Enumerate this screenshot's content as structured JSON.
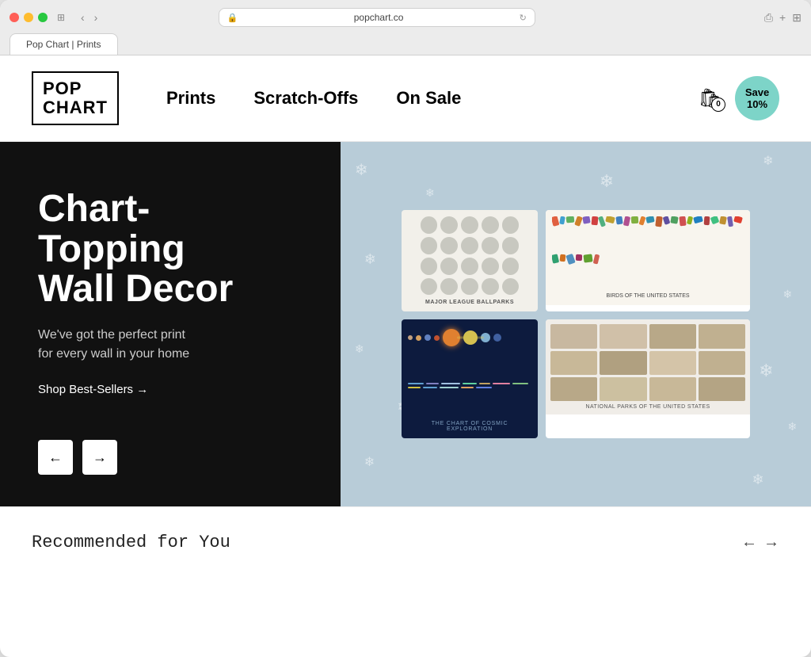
{
  "browser": {
    "url": "popchart.co",
    "tab_title": "Pop Chart | Prints"
  },
  "header": {
    "logo_line1": "POP",
    "logo_line2": "CHART",
    "nav_items": [
      {
        "label": "Prints",
        "id": "prints"
      },
      {
        "label": "Scratch-Offs",
        "id": "scratch-offs"
      },
      {
        "label": "On Sale",
        "id": "on-sale"
      }
    ],
    "cart_count": "0",
    "save_badge": "Save\n10%"
  },
  "hero": {
    "title": "Chart-\nTopping\nWall Decor",
    "subtitle": "We've got the perfect print\nfor every wall in your home",
    "cta_label": "Shop Best-Sellers →",
    "prev_label": "←",
    "next_label": "→"
  },
  "recommended": {
    "title": "Recommended for You",
    "prev_label": "←",
    "next_label": "→"
  },
  "snowflakes": [
    "❄",
    "❄",
    "❄",
    "❄",
    "❄",
    "❄",
    "❄",
    "❄",
    "❄",
    "❄",
    "❄",
    "❄"
  ]
}
